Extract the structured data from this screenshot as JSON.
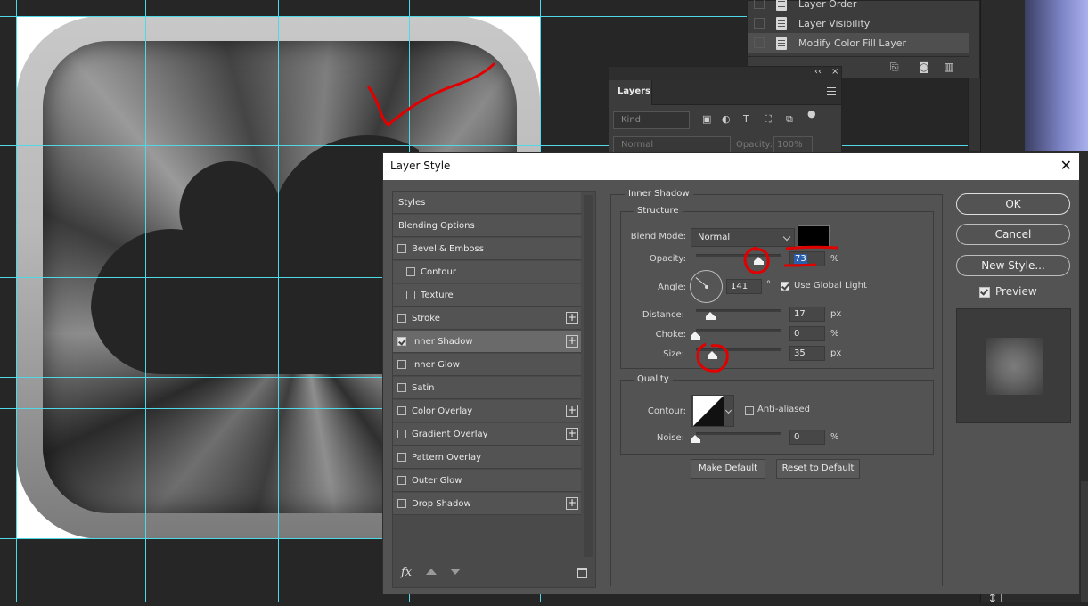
{
  "history": {
    "items": [
      {
        "label": "Layer Order",
        "selected": false
      },
      {
        "label": "Layer Visibility",
        "selected": false
      },
      {
        "label": "Modify Color Fill Layer",
        "selected": true
      }
    ]
  },
  "layers_panel": {
    "tab": "Layers",
    "collapse": "‹‹",
    "close": "×",
    "kind_placeholder": "Kind",
    "blend_mode": "Normal",
    "opacity_label": "Opacity:",
    "opacity_value": "100%"
  },
  "dialog": {
    "title": "Layer Style",
    "close": "✕",
    "styles": [
      {
        "label": "Styles",
        "type": "header",
        "checked": false,
        "plus": false,
        "selected": false
      },
      {
        "label": "Blending Options",
        "type": "header",
        "checked": false,
        "plus": false,
        "selected": false
      },
      {
        "label": "Bevel & Emboss",
        "type": "item",
        "checked": false,
        "plus": false,
        "selected": false
      },
      {
        "label": "Contour",
        "type": "sub",
        "checked": false,
        "plus": false,
        "selected": false
      },
      {
        "label": "Texture",
        "type": "sub",
        "checked": false,
        "plus": false,
        "selected": false
      },
      {
        "label": "Stroke",
        "type": "item",
        "checked": false,
        "plus": true,
        "selected": false
      },
      {
        "label": "Inner Shadow",
        "type": "item",
        "checked": true,
        "plus": true,
        "selected": true
      },
      {
        "label": "Inner Glow",
        "type": "item",
        "checked": false,
        "plus": false,
        "selected": false
      },
      {
        "label": "Satin",
        "type": "item",
        "checked": false,
        "plus": false,
        "selected": false
      },
      {
        "label": "Color Overlay",
        "type": "item",
        "checked": false,
        "plus": true,
        "selected": false
      },
      {
        "label": "Gradient Overlay",
        "type": "item",
        "checked": false,
        "plus": true,
        "selected": false
      },
      {
        "label": "Pattern Overlay",
        "type": "item",
        "checked": false,
        "plus": false,
        "selected": false
      },
      {
        "label": "Outer Glow",
        "type": "item",
        "checked": false,
        "plus": false,
        "selected": false
      },
      {
        "label": "Drop Shadow",
        "type": "item",
        "checked": false,
        "plus": true,
        "selected": false
      }
    ],
    "footer": {
      "fx": "fx"
    },
    "inner_shadow": {
      "section_title": "Inner Shadow",
      "structure_title": "Structure",
      "blend_mode_label": "Blend Mode:",
      "blend_mode_value": "Normal",
      "shadow_color": "#000000",
      "opacity_label": "Opacity:",
      "opacity_value": "73",
      "opacity_unit": "%",
      "opacity_level": 0.73,
      "angle_label": "Angle:",
      "angle_value": "141",
      "angle_unit": "°",
      "use_global_light_label": "Use Global Light",
      "use_global_light": true,
      "distance_label": "Distance:",
      "distance_value": "17",
      "distance_unit": "px",
      "choke_label": "Choke:",
      "choke_value": "0",
      "choke_unit": "%",
      "size_label": "Size:",
      "size_value": "35",
      "size_unit": "px",
      "quality_title": "Quality",
      "contour_label": "Contour:",
      "anti_aliased_label": "Anti-aliased",
      "anti_aliased": false,
      "noise_label": "Noise:",
      "noise_value": "0",
      "noise_unit": "%",
      "make_default_label": "Make Default",
      "reset_default_label": "Reset to Default"
    },
    "buttons": {
      "ok": "OK",
      "cancel": "Cancel",
      "new_style": "New Style..."
    },
    "preview": {
      "label": "Preview",
      "checked": true
    }
  },
  "colors": {
    "guide": "#4fd9e6",
    "annotation": "#e00000",
    "dialog_bg": "#535353"
  },
  "side": {
    "text_tool": "↕T"
  }
}
